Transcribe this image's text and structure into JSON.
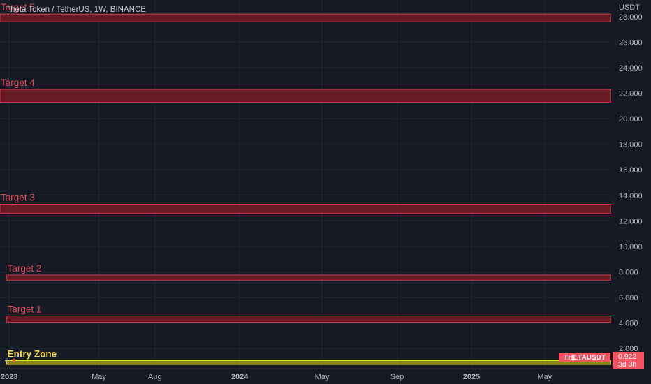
{
  "header": {
    "symbol_title": "Theta Token / TetherUS, 1W, BINANCE"
  },
  "price_axis": {
    "currency": "USDT"
  },
  "last_price": {
    "ticker": "THETAUSDT",
    "value": "0.922",
    "countdown": "3d 3h"
  },
  "colors": {
    "background": "#161a25",
    "grid": "#222733",
    "target_zone_fill": "#6b1a24",
    "target_zone_border": "#d83a4a",
    "target_label": "#e04a5a",
    "entry_zone_fill": "#8c8a1e",
    "entry_zone_border": "#e6e23a",
    "entry_label": "#f2d94a",
    "axis_text": "#b2b5be",
    "last_price_badge": "#f05561"
  },
  "chart_data": {
    "type": "area",
    "title": "Theta Token / TetherUS, 1W, BINANCE",
    "ylabel": "USDT",
    "ylim": [
      0,
      29
    ],
    "y_ticks": [
      2,
      4,
      6,
      8,
      10,
      12,
      14,
      16,
      18,
      20,
      22,
      24,
      26,
      28
    ],
    "y_tick_labels": [
      "2.000",
      "4.000",
      "6.000",
      "8.000",
      "10.000",
      "12.000",
      "14.000",
      "16.000",
      "18.000",
      "20.000",
      "22.000",
      "24.000",
      "26.000",
      "28.000"
    ],
    "x_ticks": [
      "2022-12-05",
      "2023-05-01",
      "2023-08-01",
      "2023-12-18",
      "2024-05-01",
      "2024-09-01",
      "2025-01-01",
      "2025-05-01"
    ],
    "x_tick_labels": [
      "2023",
      "May",
      "Aug",
      "2024",
      "May",
      "Sep",
      "2025",
      "May"
    ],
    "x_range": [
      "2022-11-20",
      "2025-08-18"
    ],
    "grid": true,
    "zones": [
      {
        "label": "Target 5",
        "start": "2022-11-20",
        "y_low": 27.6,
        "y_high": 28.2
      },
      {
        "label": "Target 4",
        "start": "2022-11-20",
        "y_low": 21.3,
        "y_high": 22.3
      },
      {
        "label": "Target 3",
        "start": "2022-11-20",
        "y_low": 12.6,
        "y_high": 13.3
      },
      {
        "label": "Target 2",
        "start": "2022-12-01",
        "y_low": 7.35,
        "y_high": 7.75
      },
      {
        "label": "Target 1",
        "start": "2022-12-01",
        "y_low": 4.05,
        "y_high": 4.55
      },
      {
        "label": "Entry Zone",
        "start": "2022-12-01",
        "y_low": 0.75,
        "y_high": 1.05
      }
    ],
    "last_price": 0.922
  }
}
